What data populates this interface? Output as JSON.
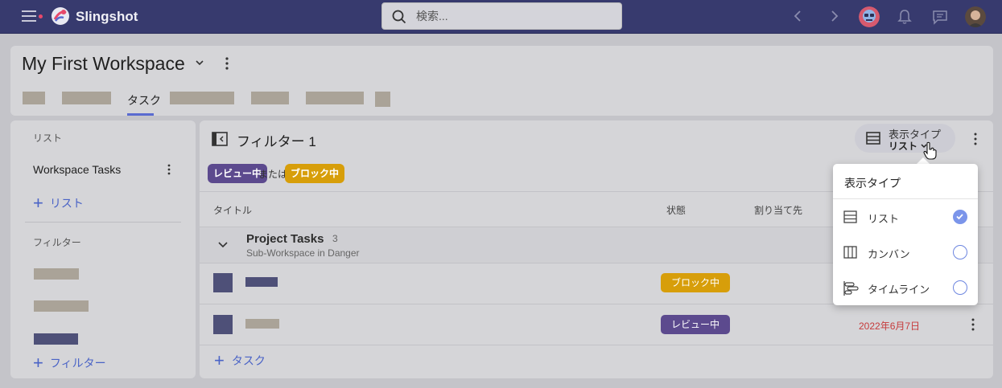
{
  "app": {
    "brand": "Slingshot",
    "accent": "#5a6bd0",
    "topbar_color": "#373a6e"
  },
  "search": {
    "placeholder": "検索..."
  },
  "workspace": {
    "title": "My First Workspace",
    "active_tab": "タスク"
  },
  "sidebar": {
    "lists_label": "リスト",
    "lists": [
      {
        "label": "Workspace Tasks"
      }
    ],
    "add_list_label": "リスト",
    "filters_label": "フィルター",
    "add_filter_label": "フィルター"
  },
  "main": {
    "filter_title": "フィルター 1",
    "view_type": {
      "label": "表示タイプ",
      "value": "リスト"
    },
    "filter_chips": [
      {
        "label": "レビュー中",
        "color": "#5c4a8e"
      },
      {
        "label": "ブロック中",
        "color": "#d79e0a"
      }
    ],
    "chip_connector": "または",
    "columns": {
      "title": "タイトル",
      "status": "状態",
      "assignee": "割り当て先"
    },
    "group": {
      "title": "Project Tasks",
      "count": "3",
      "subtitle": "Sub-Workspace in Danger"
    },
    "tasks": [
      {
        "status": "ブロック中",
        "status_color": "#d79e0a",
        "due": ""
      },
      {
        "status": "レビュー中",
        "status_color": "#5c4a8e",
        "due": "2022年6月7日"
      }
    ],
    "add_task_label": "タスク"
  },
  "dropdown": {
    "title": "表示タイプ",
    "options": [
      {
        "label": "リスト",
        "icon": "list-icon",
        "selected": true
      },
      {
        "label": "カンバン",
        "icon": "kanban-icon",
        "selected": false
      },
      {
        "label": "タイムライン",
        "icon": "timeline-icon",
        "selected": false
      }
    ]
  }
}
